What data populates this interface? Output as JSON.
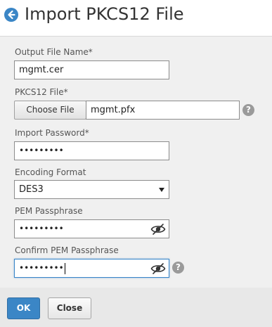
{
  "header": {
    "title": "Import PKCS12 File",
    "back_icon": "back-arrow-circle-icon"
  },
  "form": {
    "output_file_name": {
      "label": "Output File Name*",
      "value": "mgmt.cer"
    },
    "pkcs12_file": {
      "label": "PKCS12 File*",
      "choose_label": "Choose File",
      "value": "mgmt.pfx"
    },
    "import_password": {
      "label": "Import Password*",
      "value": "•••••••••"
    },
    "encoding_format": {
      "label": "Encoding Format",
      "value": "DES3"
    },
    "pem_passphrase": {
      "label": "PEM Passphrase",
      "value": "•••••••••"
    },
    "confirm_pem_passphrase": {
      "label": "Confirm PEM Passphrase",
      "value": "•••••••••"
    },
    "help_glyph": "?"
  },
  "footer": {
    "ok_label": "OK",
    "close_label": "Close"
  },
  "colors": {
    "accent": "#3b86c6",
    "help_icon": "#9a9a9a",
    "panel_bg": "#f0f0f0"
  }
}
